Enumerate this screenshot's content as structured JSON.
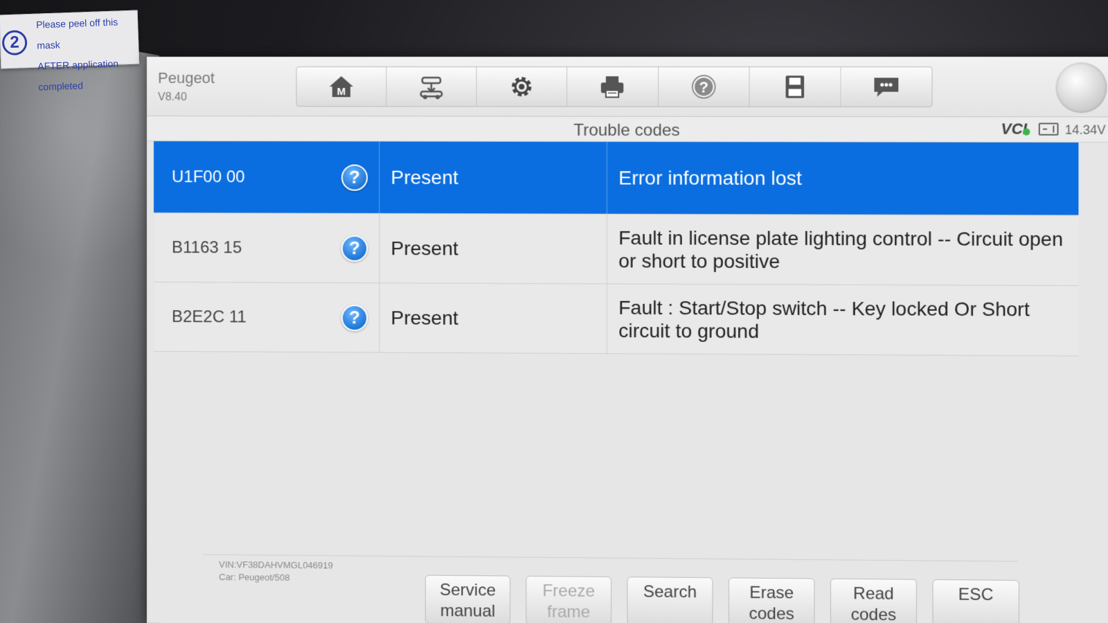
{
  "sticker": {
    "number": "2",
    "line1": "Please peel off this mask",
    "line2": "AFTER application completed"
  },
  "header": {
    "brand": "Peugeot",
    "version": "V8.40",
    "toolbar": [
      {
        "name": "home-button",
        "icon": "home-icon"
      },
      {
        "name": "vehicle-swap-button",
        "icon": "car-lift-icon"
      },
      {
        "name": "settings-button",
        "icon": "gear-icon"
      },
      {
        "name": "print-button",
        "icon": "printer-icon"
      },
      {
        "name": "help-button",
        "icon": "question-icon"
      },
      {
        "name": "save-button",
        "icon": "floppy-icon"
      },
      {
        "name": "message-button",
        "icon": "chat-icon"
      }
    ]
  },
  "titlebar": {
    "title": "Trouble codes",
    "vci": "VCI",
    "voltage": "14.34V"
  },
  "codes": [
    {
      "code": "U1F00 00",
      "status": "Present",
      "description": "Error information lost",
      "selected": true
    },
    {
      "code": "B1163 15",
      "status": "Present",
      "description": "Fault in license plate lighting control -- Circuit open or short to positive",
      "selected": false
    },
    {
      "code": "B2E2C 11",
      "status": "Present",
      "description": "Fault : Start/Stop switch -- Key locked Or Short circuit to ground",
      "selected": false
    }
  ],
  "footer": {
    "vin": "VIN:VF38DAHVMGL046919",
    "car": "Car: Peugeot/508",
    "buttons": [
      "Service manual",
      "Freeze frame",
      "Search",
      "Erase codes",
      "Read codes",
      "ESC"
    ]
  },
  "colors": {
    "selected_row": "#0b6ee0",
    "help_icon": "#1f77d6",
    "vci_ok": "#3ab54a"
  }
}
